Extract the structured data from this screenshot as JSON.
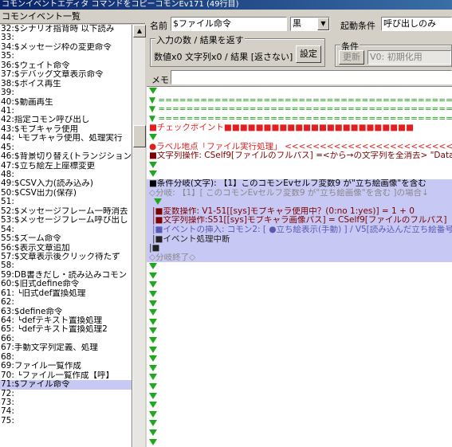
{
  "window": {
    "title": "コモンイベントエディタ コマンドをコピーコモンEv171 (49行目)"
  },
  "left_panel": {
    "header": "コモンイベント一覧",
    "items": [
      "32:$シナリオ指背時 以下読み",
      "33:",
      "34:$メッセージ枠の変更命令",
      "35:",
      "36:$ウェイト命令",
      "37:$デバッグ文章表示命令",
      "38:$ボイス再生",
      "39:",
      "40:$動画再生",
      "41:",
      "42:指定コモン呼び出し",
      "43:$モブキャラ使用",
      "44: └モブキャラ使用、処理実行",
      "45:",
      "46:$背景切り替え(トランジション",
      "47:$立ち絵左上座標変更",
      "48:",
      "49:$CSV入力(読み込み)",
      "50:$CSV出力(保存)",
      "51:",
      "52:$メッセージフレーム一時消去",
      "53:$メッセージフレーム呼び出し",
      "54:",
      "55:$ズーム命令",
      "56:$表示文章追加",
      "57:$文章表示後クリック待たず",
      "58:",
      "59:DB書きだし・読み込みコモン",
      "60:$旧式define命令",
      "61: └旧式def置換処理",
      "62:",
      "63:$define命令",
      "64: └defテキスト置換処理",
      "65: └defテキスト置換処理2",
      "66:",
      "67:手動文字列定義、処理",
      "68:",
      "69:ファイル一覧作成",
      "70: └ファイル一覧作成【呼】",
      "71:$ファイル命令",
      "72:",
      "73:",
      "74:",
      "75:"
    ],
    "selected_index": 39
  },
  "top": {
    "name_label": "名前",
    "name_value": "$ファイル命令",
    "color_value": "黒",
    "trigger_label": "起動条件",
    "trigger_value": "呼び出しのみ",
    "io_group_title": "入力の数 / 結果を返す",
    "io_summary": "数値x0 文字列x0 / 結果 [返さない]",
    "settings_button": "設定",
    "cond_group_title": "条件",
    "update_button": "更新",
    "cond_value": "V0: 初期化用",
    "memo_label": "メモ",
    "memo_value": ""
  },
  "editor": {
    "lines": [
      {
        "type": "tri"
      },
      {
        "type": "dash",
        "text": "▼ =============================================="
      },
      {
        "type": "dash",
        "text": "▼ =============================================="
      },
      {
        "type": "dash",
        "text": "▼ =============================================="
      },
      {
        "type": "red",
        "text": "■チェックポイント■■■■■■■■■■■■■■■■■■■■■■■■"
      },
      {
        "type": "tri"
      },
      {
        "type": "label",
        "text": "●ラベル地点「ファイル実行処理」 <<<<<<<<<<<<<<<<<<<<<<<<<<<"
      },
      {
        "type": "str",
        "text": "■文字列操作: CSelf9[ファイルのフルパス] =<から→の文字列を全消去> \"Data/"
      },
      {
        "type": "tri"
      },
      {
        "type": "tri"
      },
      {
        "type": "cond",
        "text": "■条件分岐(文字): 【1】このコモンEvセルフ変数9 が\"立ち絵画像\"を含む"
      },
      {
        "type": "branch",
        "text": "◇分岐: 【1】[ このコモンEvセルフ変数9 が\"立ち絵画像\"を含む ]の場合↓"
      },
      {
        "type": "tri-in"
      },
      {
        "type": "var",
        "text": "|■変数操作: V1-51[[sys]モブキャラ使用中？(0:no 1:yes)] = 1 + 0"
      },
      {
        "type": "var",
        "text": "|■文字列操作:S51[[sys]モブキャラ画像パス] = CSelf9[ファイルのフルパス]"
      },
      {
        "type": "insert",
        "text": "|■イベントの挿入: コモン2: [ ●立ち絵表示(手動) ] / V5[読み込んだ立ち絵番号"
      },
      {
        "type": "halt",
        "text": "|■イベント処理中断"
      },
      {
        "type": "sq"
      },
      {
        "type": "end",
        "text": "◇分岐終了◇"
      },
      {
        "type": "tri"
      },
      {
        "type": "tri"
      },
      {
        "type": "tri"
      },
      {
        "type": "tri"
      },
      {
        "type": "tri"
      },
      {
        "type": "tri"
      },
      {
        "type": "tri"
      },
      {
        "type": "tri"
      },
      {
        "type": "tri"
      },
      {
        "type": "tri"
      },
      {
        "type": "tri"
      },
      {
        "type": "tri"
      },
      {
        "type": "tri"
      },
      {
        "type": "tri"
      },
      {
        "type": "tri"
      },
      {
        "type": "tri"
      },
      {
        "type": "tri"
      },
      {
        "type": "tri"
      },
      {
        "type": "tri"
      },
      {
        "type": "tri"
      }
    ]
  },
  "colors": {
    "green": "#1ea81e",
    "red": "#e02020",
    "selection": "#c8c8f4",
    "titlebar": "#0a246a"
  }
}
